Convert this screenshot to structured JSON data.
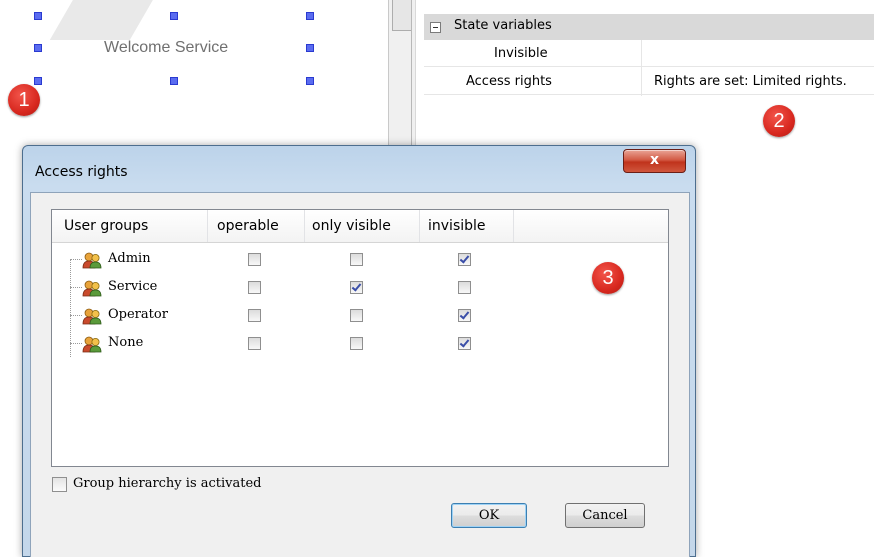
{
  "editor": {
    "element_label": "Welcome Service",
    "badge_1": "1",
    "badge_2": "2",
    "badge_3": "3"
  },
  "properties": {
    "section_label": "State variables",
    "rows": [
      {
        "name": "Invisible",
        "value": ""
      },
      {
        "name": "Access rights",
        "value": "Rights are set: Limited rights."
      }
    ]
  },
  "dialog": {
    "title": "Access rights",
    "close_label": "x",
    "columns": [
      "User groups",
      "operable",
      "only visible",
      "invisible"
    ],
    "groups": [
      {
        "name": "Admin",
        "operable": false,
        "only_visible": false,
        "invisible": true
      },
      {
        "name": "Service",
        "operable": false,
        "only_visible": true,
        "invisible": false
      },
      {
        "name": "Operator",
        "operable": false,
        "only_visible": false,
        "invisible": true
      },
      {
        "name": "None",
        "operable": false,
        "only_visible": false,
        "invisible": true
      }
    ],
    "hierarchy_label": "Group hierarchy is activated",
    "hierarchy_checked": false,
    "ok_label": "OK",
    "cancel_label": "Cancel"
  },
  "colors": {
    "handle": "#5a6cf0",
    "badge": "#d8281f",
    "close_button": "#c0331c",
    "checkmark": "#3a4ea8"
  }
}
